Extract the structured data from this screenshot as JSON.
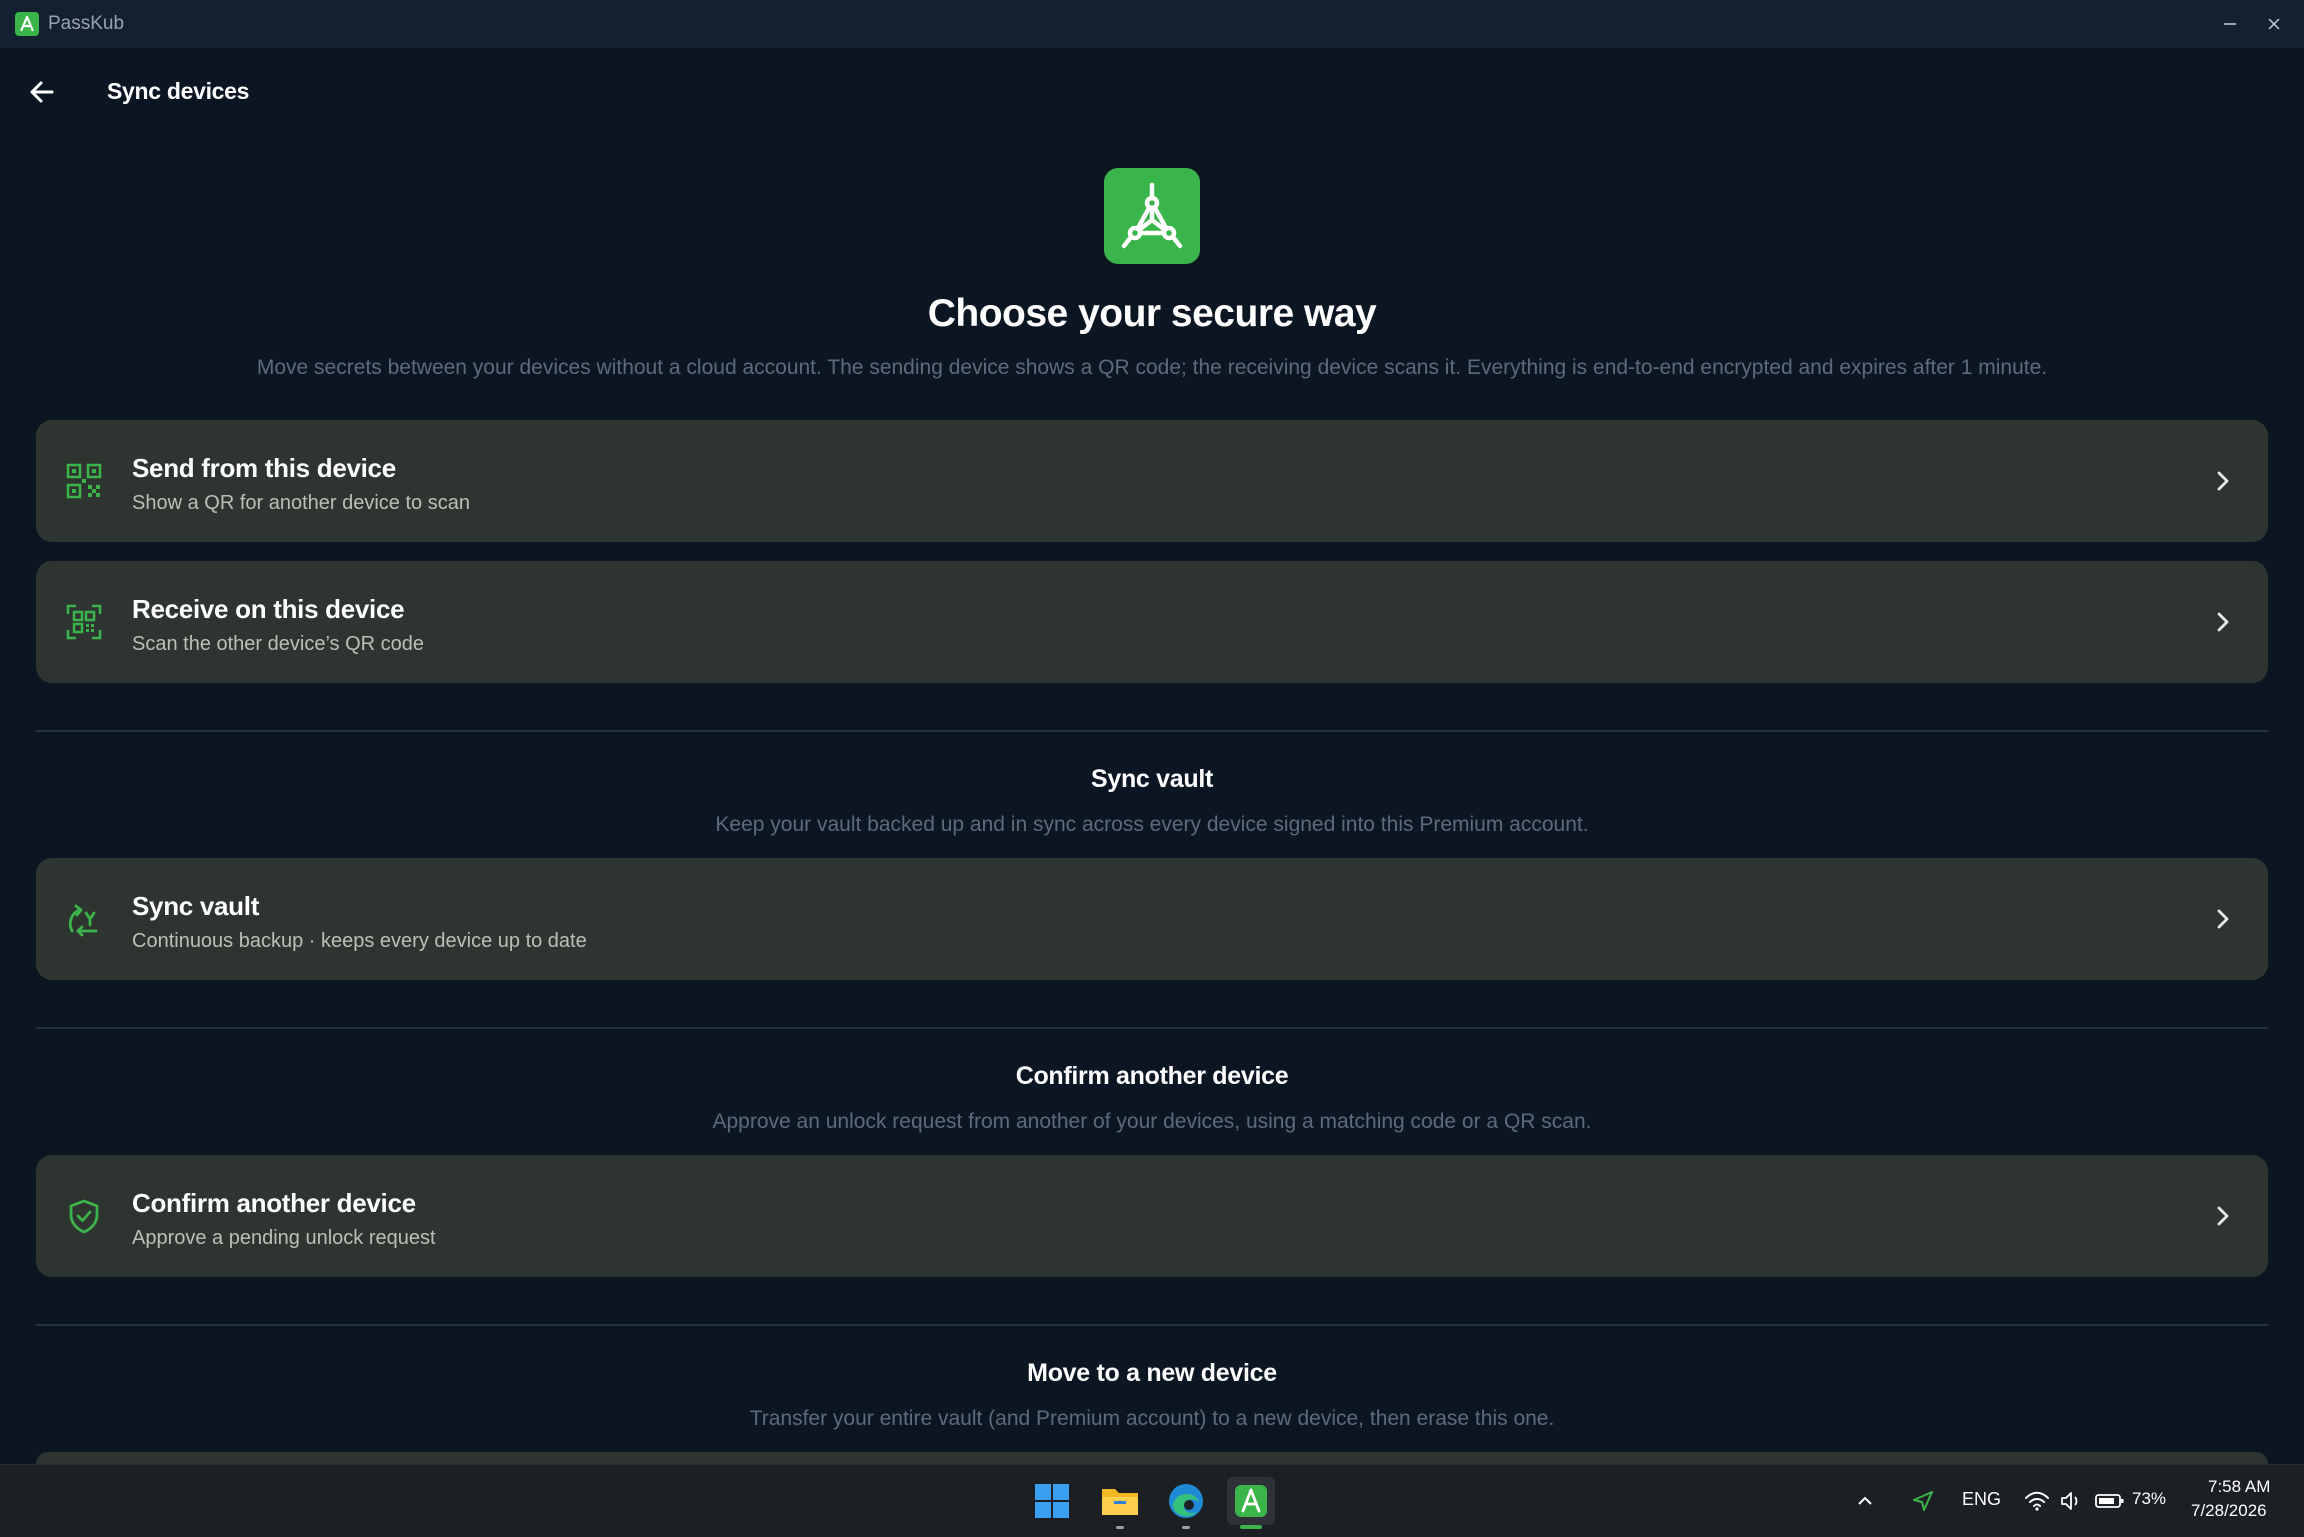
{
  "titlebar": {
    "app_name": "PassKub"
  },
  "header": {
    "title": "Sync devices"
  },
  "hero": {
    "title": "Choose your secure way",
    "subtitle": "Move secrets between your devices without a cloud account. The sending device shows a QR code; the receiving device scans it. Everything is end-to-end encrypted and expires after 1 minute."
  },
  "cards": [
    {
      "icon": "qr-code-icon",
      "title": "Send from this device",
      "subtitle": "Show a QR for another device to scan"
    },
    {
      "icon": "qr-scan-icon",
      "title": "Receive on this device",
      "subtitle": "Scan the other device’s QR code"
    }
  ],
  "sync_section": {
    "title": "Sync vault",
    "subtitle": "Keep your vault backed up and in sync across every device signed into this Premium account.",
    "card": {
      "icon": "sync-icon",
      "title": "Sync vault",
      "subtitle": "Continuous backup · keeps every device up to date"
    }
  },
  "confirm_section": {
    "title": "Confirm another device",
    "subtitle": "Approve an unlock request from another of your devices, using a matching code or a QR scan.",
    "card": {
      "icon": "shield-check-icon",
      "title": "Confirm another device",
      "subtitle": "Approve a pending unlock request"
    }
  },
  "move_section": {
    "title": "Move to a new device",
    "subtitle": "Transfer your entire vault (and Premium account) to a new device, then erase this one."
  },
  "taskbar": {
    "language": "ENG",
    "battery": "73%",
    "time": "7:58 AM",
    "date": "7/28/2026"
  },
  "colors": {
    "accent": "#3bb54a",
    "background": "#0c1623",
    "card": "#2e3530",
    "muted": "#5c6b7c"
  }
}
